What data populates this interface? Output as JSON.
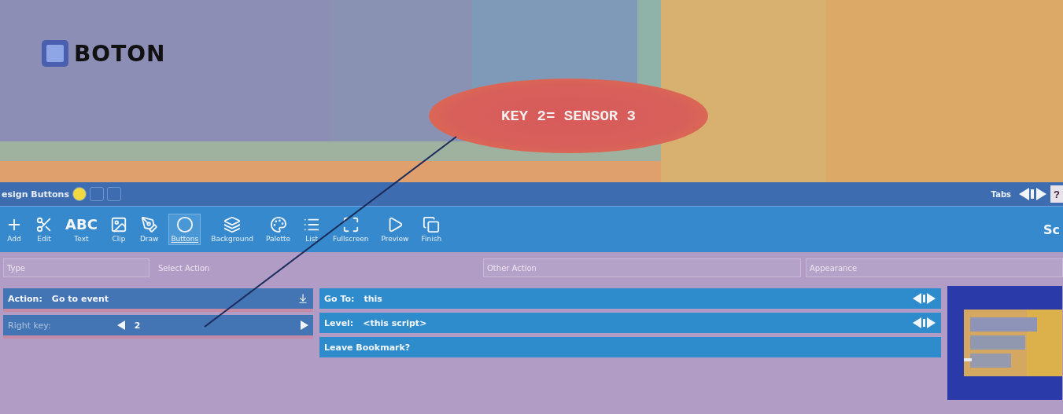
{
  "stage": {
    "logo": "BOTON",
    "callout": "KEY 2= SENSOR 3"
  },
  "titlebar": {
    "title": "esign Buttons",
    "right_label": "Tabs",
    "help": "?"
  },
  "toolbar": {
    "items": [
      {
        "label": "Add",
        "kind": "add",
        "selected": false
      },
      {
        "label": "Edit",
        "kind": "edit",
        "selected": false
      },
      {
        "label": "Text",
        "kind": "text",
        "glyph": "ABC",
        "selected": false
      },
      {
        "label": "Clip",
        "kind": "clip",
        "selected": false
      },
      {
        "label": "Draw",
        "kind": "draw",
        "selected": false
      },
      {
        "label": "Buttons",
        "kind": "buttons",
        "selected": true
      },
      {
        "label": "Background",
        "kind": "background",
        "selected": false
      },
      {
        "label": "Palette",
        "kind": "palette",
        "selected": false
      },
      {
        "label": "List",
        "kind": "list",
        "selected": false
      },
      {
        "label": "Fullscreen",
        "kind": "fullscreen",
        "selected": false
      },
      {
        "label": "Preview",
        "kind": "preview",
        "selected": false
      },
      {
        "label": "Finish",
        "kind": "finish",
        "selected": false
      }
    ],
    "cut_label": "Sc"
  },
  "headers": [
    "Type",
    "Select Action",
    "Other Action",
    "Appearance"
  ],
  "left_rows": [
    {
      "kind": "dropdown",
      "label": "Action:",
      "value": "Go to event"
    },
    {
      "kind": "stepper",
      "label": "Right key:",
      "value": "2"
    }
  ],
  "right_rows": [
    {
      "kind": "stepper",
      "label": "Go To:",
      "value": "this"
    },
    {
      "kind": "stepper",
      "label": "Level:",
      "value": "<this script>"
    },
    {
      "kind": "plain",
      "label": "Leave Bookmark?"
    }
  ]
}
